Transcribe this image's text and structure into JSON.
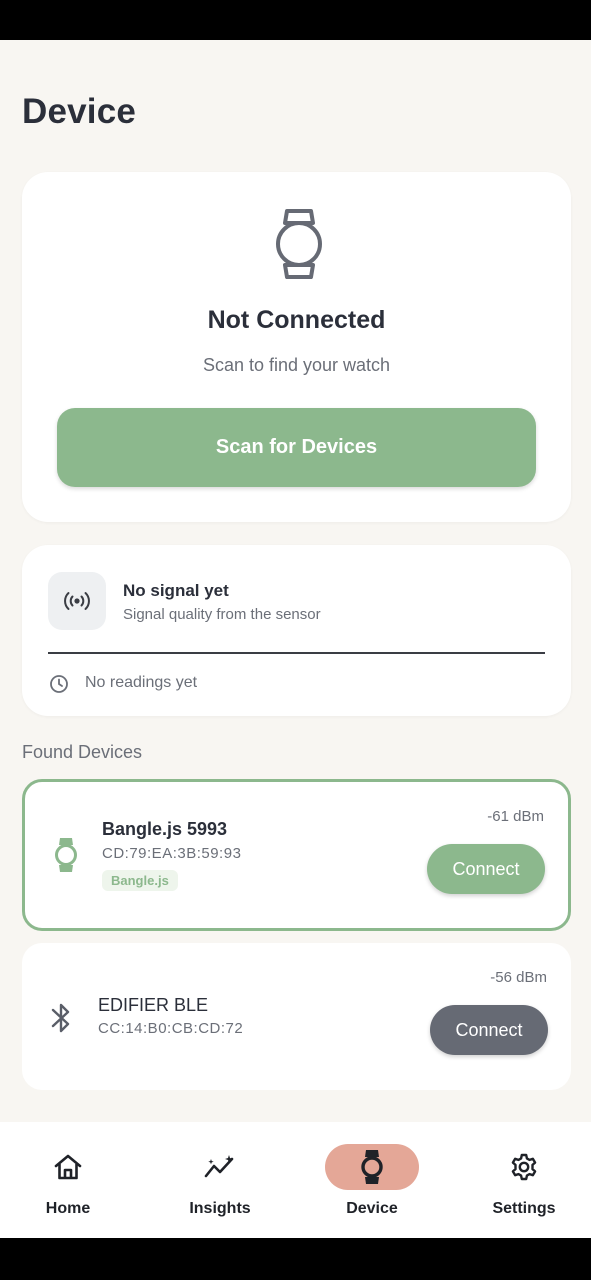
{
  "page": {
    "title": "Device"
  },
  "status": {
    "title": "Not Connected",
    "subtitle": "Scan to find your watch",
    "scan_button": "Scan for Devices"
  },
  "signal": {
    "title": "No signal yet",
    "subtitle": "Signal quality from the sensor",
    "readings": "No readings yet"
  },
  "found_devices": {
    "label": "Found Devices",
    "items": [
      {
        "name": "Bangle.js 5993",
        "address": "CD:79:EA:3B:59:93",
        "tag": "Bangle.js",
        "rssi": "-61 dBm",
        "button": "Connect",
        "icon": "watch-icon"
      },
      {
        "name": "EDIFIER BLE",
        "address": "CC:14:B0:CB:CD:72",
        "rssi": "-56 dBm",
        "button": "Connect",
        "icon": "bluetooth-icon"
      }
    ]
  },
  "nav": {
    "items": [
      {
        "label": "Home",
        "icon": "home-icon"
      },
      {
        "label": "Insights",
        "icon": "insights-icon"
      },
      {
        "label": "Device",
        "icon": "watch-icon",
        "active": true
      },
      {
        "label": "Settings",
        "icon": "gear-icon"
      }
    ]
  },
  "colors": {
    "accent": "#8cb88d",
    "nav_active": "#e4a797",
    "text_primary": "#2b2f3a",
    "background": "#f8f6f2"
  }
}
